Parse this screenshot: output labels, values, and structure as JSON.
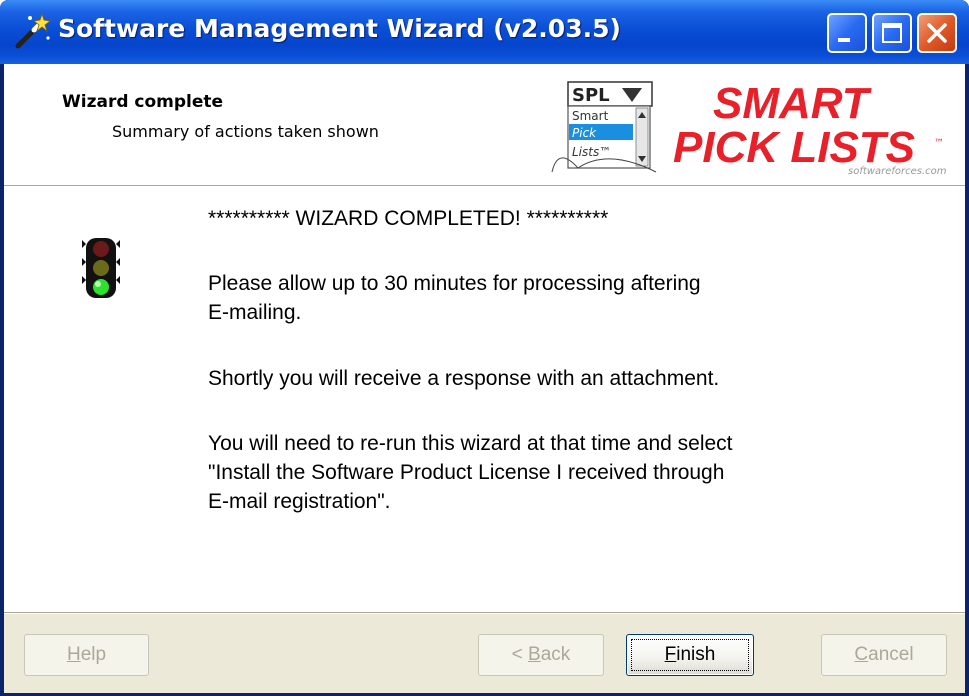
{
  "window": {
    "title": "Software Management Wizard (v2.03.5)"
  },
  "header": {
    "title": "Wizard complete",
    "subtitle": "Summary of actions taken shown"
  },
  "logo": {
    "badge_text": "SPL",
    "list_items": [
      "Smart",
      "Pick",
      "Lists™"
    ],
    "brand_line1": "SMART",
    "brand_line2": "PICK LISTS",
    "tm": "™",
    "domain": "softwareforces.com"
  },
  "content": {
    "heading": "********** WIZARD COMPLETED! **********",
    "para1": "Please allow up to 30 minutes for processing aftering\nE-mailing.",
    "para2": "Shortly you will receive a response with an attachment.",
    "para3": "You will need to re-run this wizard at that time and select\n\"Install the Software Product License I received through\nE-mail registration\"."
  },
  "buttons": {
    "help": {
      "accel": "H",
      "rest": "elp",
      "enabled": false
    },
    "back": {
      "prefix": "< ",
      "accel": "B",
      "rest": "ack",
      "enabled": false
    },
    "finish": {
      "accel": "F",
      "rest": "inish",
      "enabled": true
    },
    "cancel": {
      "accel": "C",
      "rest": "ancel",
      "enabled": false
    }
  },
  "colors": {
    "titlebar": "#0a4fd6",
    "brand_red": "#e8202a",
    "panel": "#ece9d8"
  },
  "icons": {
    "app": "wizard-wand-icon",
    "status": "traffic-light-icon"
  }
}
